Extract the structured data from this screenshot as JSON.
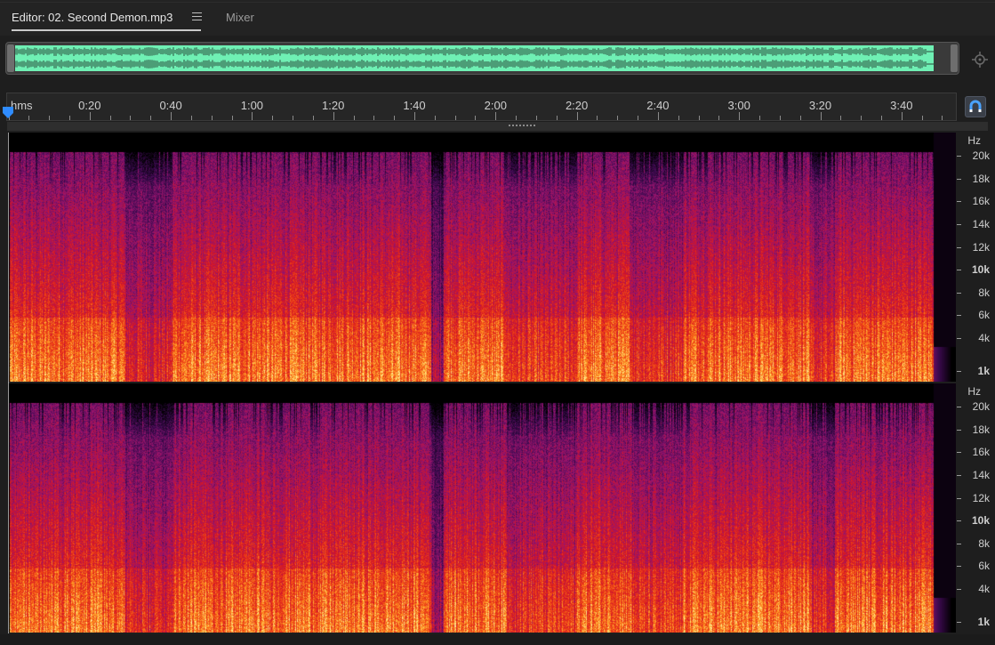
{
  "tabs": {
    "editor": "Editor: 02. Second Demon.mp3",
    "mixer": "Mixer"
  },
  "ruler": {
    "unit": "hms",
    "labels": [
      "0:20",
      "0:40",
      "1:00",
      "1:20",
      "1:40",
      "2:00",
      "2:20",
      "2:40",
      "3:00",
      "3:20",
      "3:40"
    ]
  },
  "frequency_axis": {
    "unit": "Hz",
    "labels": [
      "20k",
      "18k",
      "16k",
      "14k",
      "12k",
      "10k",
      "8k",
      "6k",
      "4k",
      "1k"
    ],
    "bold": [
      "10k",
      "1k"
    ]
  },
  "colors": {
    "overview_waveform": "#6ff0b4",
    "playhead": "#2f8cff",
    "snap_button_icon": "#4aa3ff"
  },
  "icons": {
    "menu": "hamburger-icon",
    "zoom_navigator": "crosshair-icon",
    "snap": "magnet-icon",
    "playhead": "playhead-marker-icon"
  }
}
